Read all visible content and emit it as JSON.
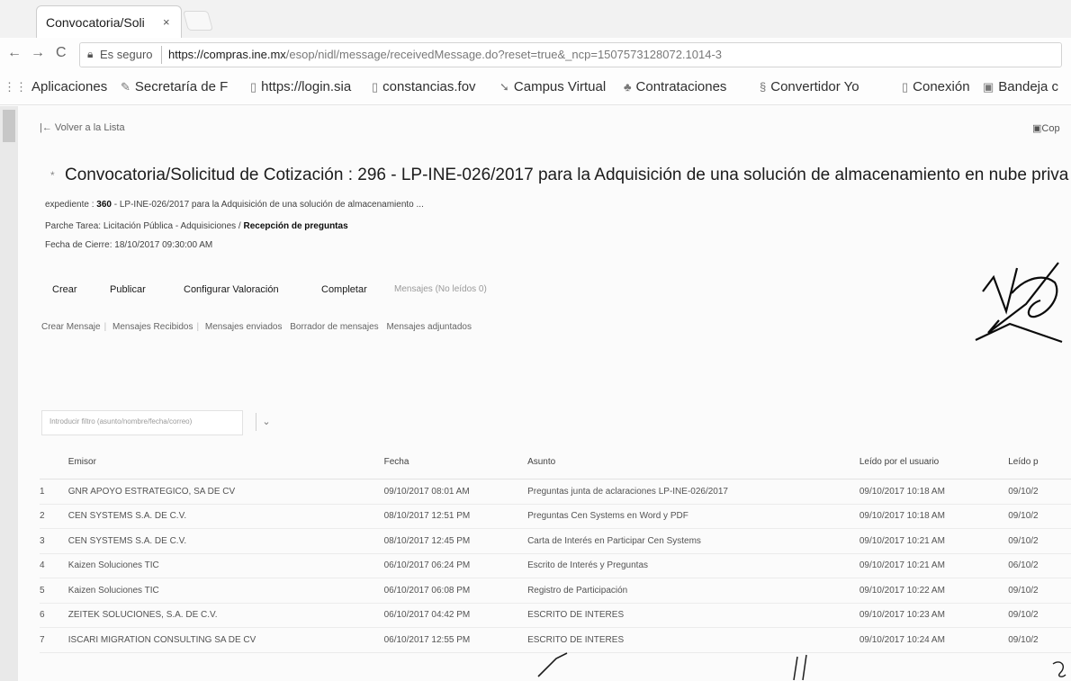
{
  "browser": {
    "tab_title": "Convocatoria/Soli",
    "close_glyph": "×",
    "secure_label": "Es seguro",
    "url_host": "https://compras.ine.mx",
    "url_path": "/esop/nidl/message/receivedMessage.do?reset=true&_ncp=1507573128072.1014-3"
  },
  "bookmarks": [
    {
      "label": "Aplicaciones",
      "icon": "apps-grid-icon"
    },
    {
      "label": "Secretaría de F",
      "icon": "bookmark-icon"
    },
    {
      "label": "https://login.sia",
      "icon": "page-icon"
    },
    {
      "label": "constancias.fov",
      "icon": "page-icon"
    },
    {
      "label": "Campus Virtual",
      "icon": "campus-icon"
    },
    {
      "label": "Contrataciones",
      "icon": "contrataciones-icon"
    },
    {
      "label": "Convertidor Yo",
      "icon": "converter-icon"
    },
    {
      "label": "Conexión",
      "icon": "page-icon"
    },
    {
      "label": "Bandeja c",
      "icon": "inbox-icon"
    }
  ],
  "page": {
    "back_label": "Volver a la Lista",
    "copy_label": "Cop",
    "title": "Convocatoria/Solicitud de Cotización : 296 - LP-INE-026/2017 para la Adquisición de una solución de almacenamiento en nube priva",
    "expediente_label": "expediente :",
    "expediente_number": "360",
    "expediente_rest": " - LP-INE-026/2017 para la Adquisición de una solución de almacenamiento ...",
    "task_prefix": "Parche Tarea: Licitación Pública - Adquisiciones / ",
    "task_stage": "Recepción de preguntas",
    "closing_date": "Fecha de Cierre: 18/10/2017 09:30:00 AM"
  },
  "toolbar": [
    "Crear",
    "Publicar",
    "Configurar Valoración",
    "Completar",
    "Mensajes (No leídos 0)"
  ],
  "subnav": [
    "Crear Mensaje",
    "Mensajes Recibidos",
    "Mensajes enviados",
    "Borrador de mensajes",
    "Mensajes adjuntados"
  ],
  "filter": {
    "placeholder": "Introducir filtro (asunto/nombre/fecha/correo)"
  },
  "table": {
    "headers": [
      "",
      "Emisor",
      "Fecha",
      "Asunto",
      "Leído por el usuario",
      "Leído p"
    ],
    "rows": [
      [
        "1",
        "GNR APOYO ESTRATEGICO, SA DE CV",
        "09/10/2017 08:01 AM",
        "Preguntas junta de aclaraciones LP-INE-026/2017",
        "09/10/2017 10:18 AM",
        "09/10/2"
      ],
      [
        "2",
        "CEN SYSTEMS S.A. DE C.V.",
        "08/10/2017 12:51 PM",
        "Preguntas Cen Systems en Word y PDF",
        "09/10/2017 10:18 AM",
        "09/10/2"
      ],
      [
        "3",
        "CEN SYSTEMS S.A. DE C.V.",
        "08/10/2017 12:45 PM",
        "Carta de Interés en Participar Cen Systems",
        "09/10/2017 10:21 AM",
        "09/10/2"
      ],
      [
        "4",
        "Kaizen Soluciones TIC",
        "06/10/2017 06:24 PM",
        "Escrito de Interés y Preguntas",
        "09/10/2017 10:21 AM",
        "06/10/2"
      ],
      [
        "5",
        "Kaizen Soluciones TIC",
        "06/10/2017 06:08 PM",
        "Registro de Participación",
        "09/10/2017 10:22 AM",
        "09/10/2"
      ],
      [
        "6",
        "ZEITEK SOLUCIONES, S.A. DE C.V.",
        "06/10/2017 04:42 PM",
        "ESCRITO DE INTERES",
        "09/10/2017 10:23 AM",
        "09/10/2"
      ],
      [
        "7",
        "ISCARI MIGRATION CONSULTING SA DE CV",
        "06/10/2017 12:55 PM",
        "ESCRITO DE INTERES",
        "09/10/2017 10:24 AM",
        "09/10/2"
      ]
    ]
  }
}
